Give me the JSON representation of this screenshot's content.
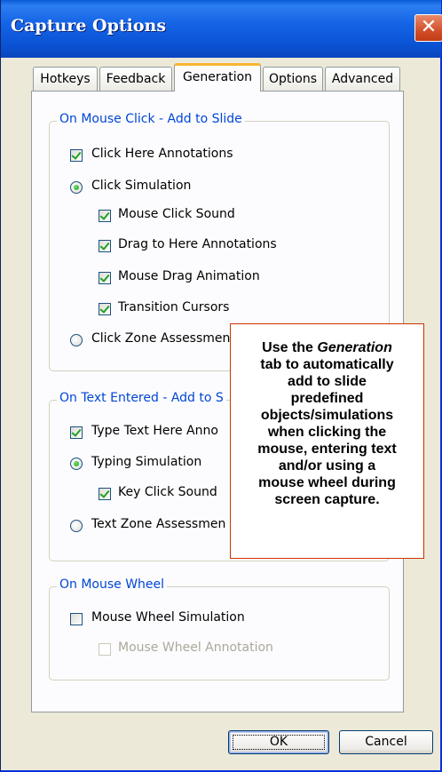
{
  "window": {
    "title": "Capture Options",
    "close_glyph": "✕"
  },
  "tabs": [
    {
      "label": "Hotkeys",
      "active": false
    },
    {
      "label": "Feedback",
      "active": false
    },
    {
      "label": "Generation",
      "active": true
    },
    {
      "label": "Options",
      "active": false
    },
    {
      "label": "Advanced",
      "active": false
    }
  ],
  "groups": {
    "mouse_click": {
      "legend": "On Mouse Click - Add to Slide",
      "items": [
        {
          "type": "checkbox",
          "label": "Click Here Annotations",
          "checked": true
        },
        {
          "type": "radio",
          "label": "Click Simulation",
          "checked": true
        },
        {
          "type": "checkbox",
          "label": "Mouse Click Sound",
          "checked": true
        },
        {
          "type": "checkbox",
          "label": "Drag to Here Annotations",
          "checked": true
        },
        {
          "type": "checkbox",
          "label": "Mouse Drag Animation",
          "checked": true
        },
        {
          "type": "checkbox",
          "label": "Transition Cursors",
          "checked": true
        },
        {
          "type": "radio",
          "label": "Click Zone Assessmen",
          "checked": false
        }
      ]
    },
    "text_entered": {
      "legend": "On Text Entered - Add to S",
      "items": [
        {
          "type": "checkbox",
          "label": "Type Text Here Anno",
          "checked": true
        },
        {
          "type": "radio",
          "label": "Typing Simulation",
          "checked": true
        },
        {
          "type": "checkbox",
          "label": "Key Click Sound",
          "checked": true
        },
        {
          "type": "radio",
          "label": "Text Zone Assessmen",
          "checked": false
        }
      ]
    },
    "mouse_wheel": {
      "legend": "On Mouse Wheel",
      "items": [
        {
          "type": "checkbox",
          "label": "Mouse Wheel Simulation",
          "checked": false
        },
        {
          "type": "checkbox",
          "label": "Mouse Wheel Annotation",
          "checked": false,
          "disabled": true
        }
      ]
    }
  },
  "callout": {
    "lines": [
      "Use the ",
      "Generation",
      "tab to automatically",
      "add to slide",
      "predefined",
      "objects/simulations",
      "when clicking the",
      "mouse, entering text",
      "and/or using a",
      "mouse wheel during",
      "screen capture."
    ],
    "border_color": "#cc3300"
  },
  "buttons": {
    "ok": "OK",
    "cancel": "Cancel"
  },
  "colors": {
    "titlebar": "#0a5bd8",
    "legend": "#0046d5",
    "face": "#ece9d8",
    "check": "#21a121"
  }
}
